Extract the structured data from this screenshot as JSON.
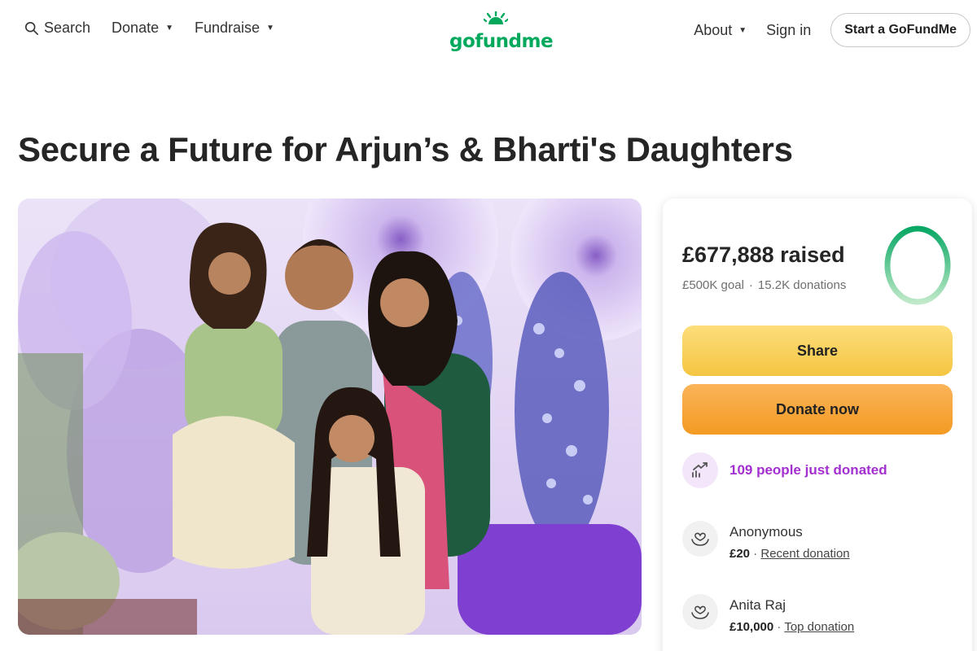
{
  "nav": {
    "search_label": "Search",
    "donate_label": "Donate",
    "fundraise_label": "Fundraise",
    "about_label": "About",
    "signin_label": "Sign in",
    "start_label": "Start a GoFundMe"
  },
  "logo": {
    "text": "gofundme",
    "color": "#02a95c"
  },
  "campaign": {
    "title": "Secure a Future for Arjun’s & Bharti's Daughters"
  },
  "donation": {
    "raised": "£677,888 raised",
    "goal": "£500K goal",
    "separator": "·",
    "count": "15.2K donations",
    "progress_fraction": 1.0,
    "share_label": "Share",
    "donate_label": "Donate now",
    "trend_text": "109 people just donated",
    "donors": [
      {
        "name": "Anonymous",
        "amount": "£20",
        "separator": "·",
        "tag": "Recent donation"
      },
      {
        "name": "Anita Raj",
        "amount": "£10,000",
        "separator": "·",
        "tag": "Top donation"
      }
    ]
  },
  "colors": {
    "brand_green": "#02a95c",
    "share_yellow": "#f4c542",
    "donate_orange": "#f39a22",
    "trend_purple": "#a32fd0"
  }
}
